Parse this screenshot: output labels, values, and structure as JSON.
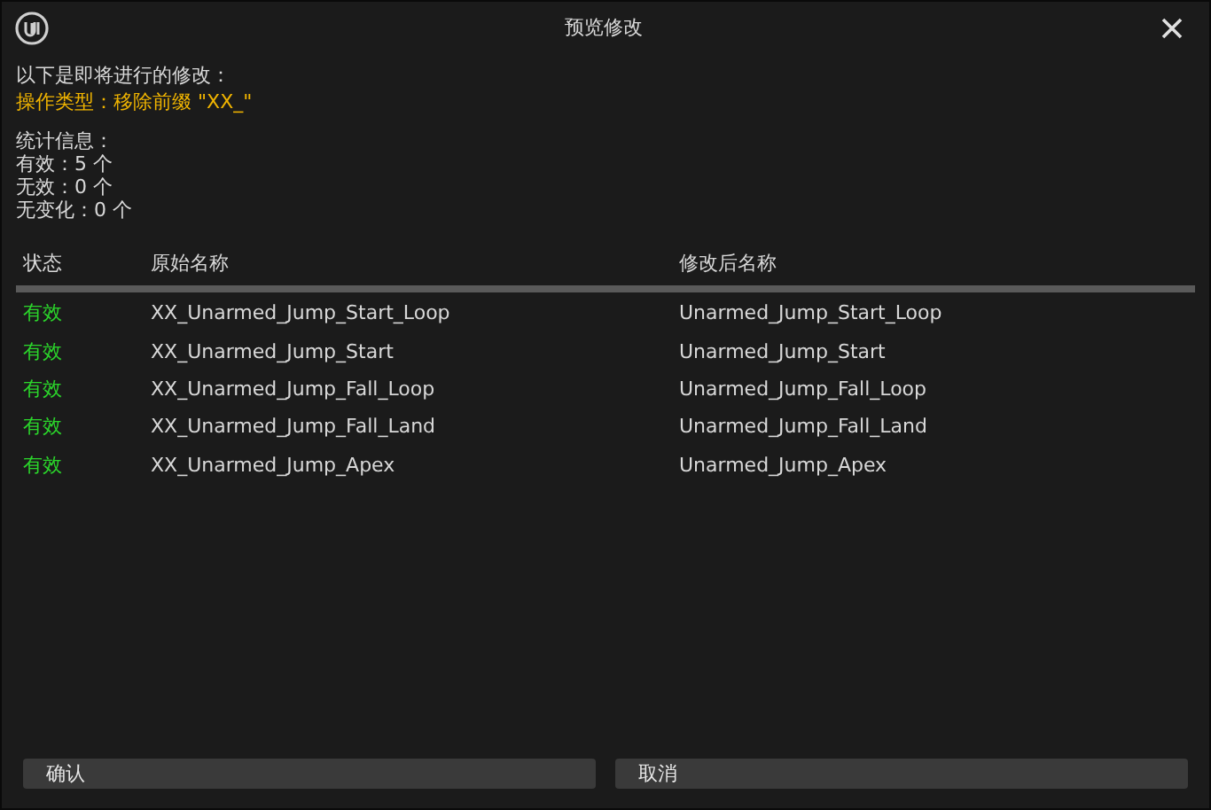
{
  "window": {
    "title": "预览修改"
  },
  "intro": "以下是即将进行的修改：",
  "operation": "操作类型：移除前缀 \"XX_\"",
  "stats": {
    "heading": "统计信息：",
    "lines": [
      "有效：5 个",
      "无效：0 个",
      "无变化：0 个"
    ]
  },
  "table": {
    "columns": [
      "状态",
      "原始名称",
      "修改后名称"
    ],
    "rows": [
      {
        "status": "有效",
        "valid": true,
        "original": "XX_Unarmed_Jump_Start_Loop",
        "renamed": "Unarmed_Jump_Start_Loop"
      },
      {
        "status": "有效",
        "valid": true,
        "original": "XX_Unarmed_Jump_Start",
        "renamed": "Unarmed_Jump_Start"
      },
      {
        "status": "有效",
        "valid": true,
        "original": "XX_Unarmed_Jump_Fall_Loop",
        "renamed": "Unarmed_Jump_Fall_Loop"
      },
      {
        "status": "有效",
        "valid": true,
        "original": "XX_Unarmed_Jump_Fall_Land",
        "renamed": "Unarmed_Jump_Fall_Land"
      },
      {
        "status": "有效",
        "valid": true,
        "original": "XX_Unarmed_Jump_Apex",
        "renamed": "Unarmed_Jump_Apex"
      }
    ]
  },
  "buttons": [
    "确认",
    "取消"
  ]
}
